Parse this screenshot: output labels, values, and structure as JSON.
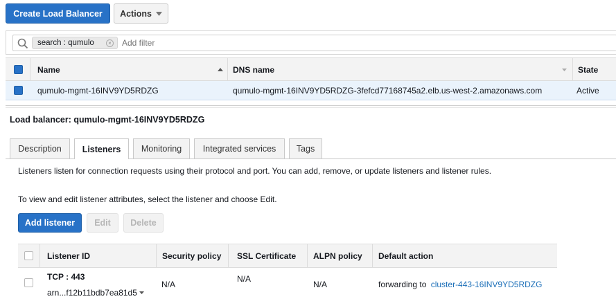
{
  "toolbar": {
    "create_label": "Create Load Balancer",
    "actions_label": "Actions"
  },
  "filter": {
    "token_label": "search : qumulo",
    "placeholder": "Add filter"
  },
  "lb_table": {
    "columns": [
      "Name",
      "DNS name",
      "State"
    ],
    "row": {
      "name": "qumulo-mgmt-16INV9YD5RDZG",
      "dns": "qumulo-mgmt-16INV9YD5RDZG-3fefcd77168745a2.elb.us-west-2.amazonaws.com",
      "state": "Active"
    }
  },
  "details": {
    "heading": "Load balancer: qumulo-mgmt-16INV9YD5RDZG",
    "tabs": [
      "Description",
      "Listeners",
      "Monitoring",
      "Integrated services",
      "Tags"
    ],
    "active_tab": "Listeners",
    "intro_text": "Listeners listen for connection requests using their protocol and port. You can add, remove, or update listeners and listener rules.",
    "edit_text": "To view and edit listener attributes, select the listener and choose Edit.",
    "buttons": {
      "add": "Add listener",
      "edit": "Edit",
      "delete": "Delete"
    },
    "listener_table": {
      "columns": [
        "Listener ID",
        "Security policy",
        "SSL Certificate",
        "ALPN policy",
        "Default action"
      ],
      "row": {
        "id": "TCP : 443",
        "arn": "arn...f12b11bdb7ea81d5",
        "security_policy": "N/A",
        "ssl_certificate": "N/A",
        "alpn_policy": "N/A",
        "action_prefix": "forwarding to",
        "action_target": "cluster-443-16INV9YD5RDZG"
      }
    }
  },
  "colors": {
    "primary": "#2872c7",
    "selected_row": "#eaf3fc",
    "link": "#1c6fb8"
  }
}
